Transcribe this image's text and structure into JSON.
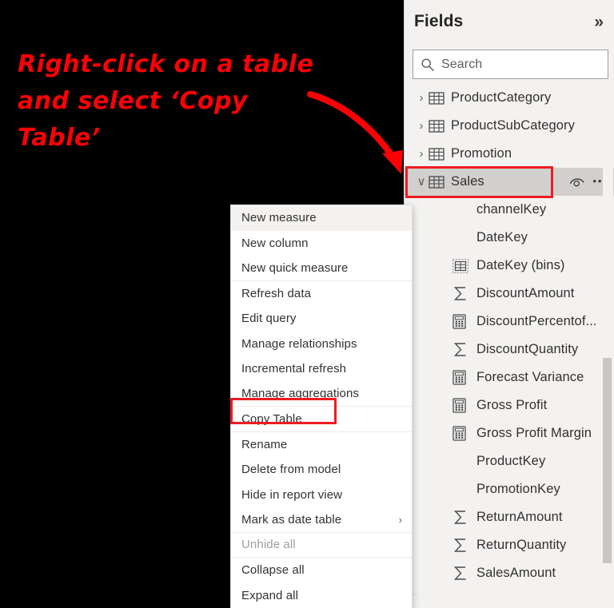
{
  "annotation": {
    "text": "Right-click on a table\nand select ‘Copy\nTable’",
    "color": "#fc0006",
    "arrow_name": "curved-arrow"
  },
  "panel": {
    "title": "Fields",
    "collapse_label": "»",
    "search": {
      "placeholder": "Search",
      "value": "Search",
      "icon": "search-icon"
    },
    "tables": [
      {
        "label": "ProductCategory",
        "chevron": "›",
        "icon": "table-icon",
        "expanded": false,
        "selected": false
      },
      {
        "label": "ProductSubCategory",
        "chevron": "›",
        "icon": "table-icon",
        "expanded": false,
        "selected": false
      },
      {
        "label": "Promotion",
        "chevron": "›",
        "icon": "table-icon",
        "expanded": false,
        "selected": false
      },
      {
        "label": "Sales",
        "chevron": "∨",
        "icon": "table-icon",
        "expanded": true,
        "selected": true
      }
    ],
    "sales_actions": {
      "eye_icon": "eye-icon",
      "more_icon": "ellipsis-icon"
    },
    "fields": [
      {
        "label": "channelKey",
        "icon": "none"
      },
      {
        "label": "DateKey",
        "icon": "none"
      },
      {
        "label": "DateKey (bins)",
        "icon": "bins-icon"
      },
      {
        "label": "DiscountAmount",
        "icon": "sigma-icon"
      },
      {
        "label": "DiscountPercentof...",
        "icon": "measure-icon"
      },
      {
        "label": "DiscountQuantity",
        "icon": "sigma-icon"
      },
      {
        "label": "Forecast Variance",
        "icon": "measure-icon"
      },
      {
        "label": "Gross Profit",
        "icon": "measure-icon"
      },
      {
        "label": "Gross Profit Margin",
        "icon": "measure-icon"
      },
      {
        "label": "ProductKey",
        "icon": "none"
      },
      {
        "label": "PromotionKey",
        "icon": "none"
      },
      {
        "label": "ReturnAmount",
        "icon": "sigma-icon"
      },
      {
        "label": "ReturnQuantity",
        "icon": "sigma-icon"
      },
      {
        "label": "SalesAmount",
        "icon": "sigma-icon"
      }
    ]
  },
  "context_menu": {
    "items": [
      {
        "label": "New measure",
        "hovered": true,
        "disabled": false,
        "separator_after": false,
        "submenu": false,
        "highlighted": false
      },
      {
        "label": "New column",
        "hovered": false,
        "disabled": false,
        "separator_after": false,
        "submenu": false,
        "highlighted": false
      },
      {
        "label": "New quick measure",
        "hovered": false,
        "disabled": false,
        "separator_after": true,
        "submenu": false,
        "highlighted": false
      },
      {
        "label": "Refresh data",
        "hovered": false,
        "disabled": false,
        "separator_after": false,
        "submenu": false,
        "highlighted": false
      },
      {
        "label": "Edit query",
        "hovered": false,
        "disabled": false,
        "separator_after": false,
        "submenu": false,
        "highlighted": false
      },
      {
        "label": "Manage relationships",
        "hovered": false,
        "disabled": false,
        "separator_after": false,
        "submenu": false,
        "highlighted": false
      },
      {
        "label": "Incremental refresh",
        "hovered": false,
        "disabled": false,
        "separator_after": false,
        "submenu": false,
        "highlighted": false
      },
      {
        "label": "Manage aggregations",
        "hovered": false,
        "disabled": false,
        "separator_after": true,
        "submenu": false,
        "highlighted": false
      },
      {
        "label": "Copy Table",
        "hovered": false,
        "disabled": false,
        "separator_after": true,
        "submenu": false,
        "highlighted": true
      },
      {
        "label": "Rename",
        "hovered": false,
        "disabled": false,
        "separator_after": false,
        "submenu": false,
        "highlighted": false
      },
      {
        "label": "Delete from model",
        "hovered": false,
        "disabled": false,
        "separator_after": false,
        "submenu": false,
        "highlighted": false
      },
      {
        "label": "Hide in report view",
        "hovered": false,
        "disabled": false,
        "separator_after": false,
        "submenu": false,
        "highlighted": false
      },
      {
        "label": "Mark as date table",
        "hovered": false,
        "disabled": false,
        "separator_after": true,
        "submenu": true,
        "highlighted": false,
        "submenu_arrow": "›"
      },
      {
        "label": "Unhide all",
        "hovered": false,
        "disabled": true,
        "separator_after": true,
        "submenu": false,
        "highlighted": false
      },
      {
        "label": "Collapse all",
        "hovered": false,
        "disabled": false,
        "separator_after": false,
        "submenu": false,
        "highlighted": false
      },
      {
        "label": "Expand all",
        "hovered": false,
        "disabled": false,
        "separator_after": false,
        "submenu": false,
        "highlighted": false
      }
    ]
  },
  "colors": {
    "annotation_red": "#fc0006",
    "highlight_red": "#ec1c24",
    "panel_bg": "#f3f2f1",
    "selected_row": "#d2d0ce",
    "menu_bg": "#ffffff",
    "text": "#323130"
  }
}
